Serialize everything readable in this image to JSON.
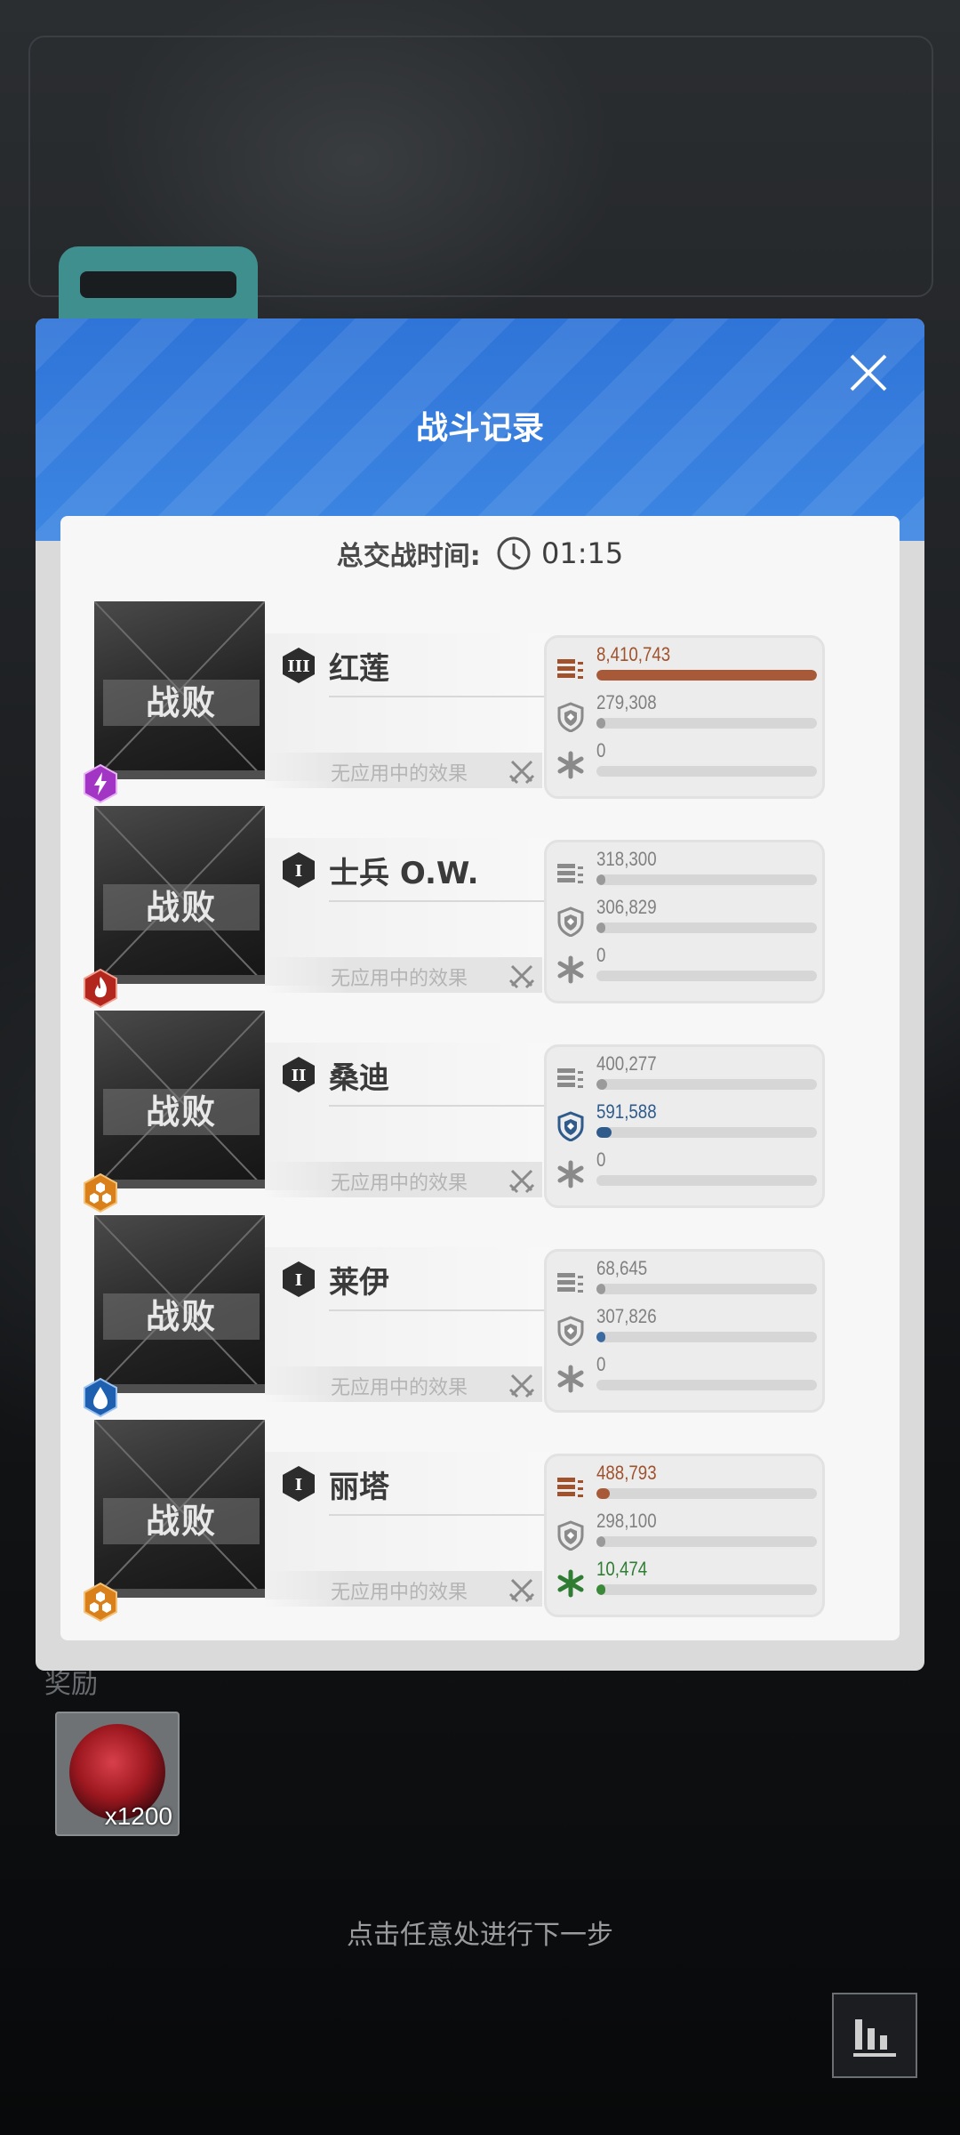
{
  "dialog": {
    "title": "战斗记录",
    "duration_label": "总交战时间:",
    "duration_value": "01:15"
  },
  "units": [
    {
      "name": "红莲",
      "rank": "III",
      "status": "战败",
      "element_icon": "lightning-icon",
      "element_color": "#a335c4",
      "effect_text": "无应用中的效果",
      "stats": [
        {
          "icon": "ammo-icon",
          "value": "8,410,743",
          "fill": 1.0,
          "color": "#a85a38",
          "text_color": "#a0522d"
        },
        {
          "icon": "shield-icon",
          "value": "279,308",
          "fill": 0.03,
          "color": "#9a9a9a",
          "text_color": "#808080"
        },
        {
          "icon": "heal-icon",
          "value": "0",
          "fill": 0.0,
          "color": "#9a9a9a",
          "text_color": "#808080"
        }
      ]
    },
    {
      "name": "士兵 O.W.",
      "rank": "I",
      "status": "战败",
      "element_icon": "fire-icon",
      "element_color": "#b3261e",
      "effect_text": "无应用中的效果",
      "stats": [
        {
          "icon": "ammo-icon",
          "value": "318,300",
          "fill": 0.03,
          "color": "#9a9a9a",
          "text_color": "#808080"
        },
        {
          "icon": "shield-icon",
          "value": "306,829",
          "fill": 0.03,
          "color": "#9a9a9a",
          "text_color": "#808080"
        },
        {
          "icon": "heal-icon",
          "value": "0",
          "fill": 0.0,
          "color": "#9a9a9a",
          "text_color": "#808080"
        }
      ]
    },
    {
      "name": "桑迪",
      "rank": "II",
      "status": "战败",
      "element_icon": "iron-icon",
      "element_color": "#d9801a",
      "effect_text": "无应用中的效果",
      "stats": [
        {
          "icon": "ammo-icon",
          "value": "400,277",
          "fill": 0.05,
          "color": "#9a9a9a",
          "text_color": "#808080"
        },
        {
          "icon": "shield-icon",
          "value": "591,588",
          "fill": 0.07,
          "color": "#2e5a8c",
          "text_color": "#2e5a8c"
        },
        {
          "icon": "heal-icon",
          "value": "0",
          "fill": 0.0,
          "color": "#9a9a9a",
          "text_color": "#808080"
        }
      ]
    },
    {
      "name": "莱伊",
      "rank": "I",
      "status": "战败",
      "element_icon": "water-icon",
      "element_color": "#1f5fb0",
      "effect_text": "无应用中的效果",
      "stats": [
        {
          "icon": "ammo-icon",
          "value": "68,645",
          "fill": 0.01,
          "color": "#9a9a9a",
          "text_color": "#808080"
        },
        {
          "icon": "shield-icon",
          "value": "307,826",
          "fill": 0.03,
          "color": "#3a6aa0",
          "text_color": "#808080"
        },
        {
          "icon": "heal-icon",
          "value": "0",
          "fill": 0.0,
          "color": "#9a9a9a",
          "text_color": "#808080"
        }
      ]
    },
    {
      "name": "丽塔",
      "rank": "I",
      "status": "战败",
      "element_icon": "iron-icon",
      "element_color": "#d9801a",
      "effect_text": "无应用中的效果",
      "stats": [
        {
          "icon": "ammo-icon",
          "value": "488,793",
          "fill": 0.06,
          "color": "#a85a38",
          "text_color": "#a0522d"
        },
        {
          "icon": "shield-icon",
          "value": "298,100",
          "fill": 0.03,
          "color": "#9a9a9a",
          "text_color": "#808080"
        },
        {
          "icon": "heal-icon",
          "value": "10,474",
          "fill": 0.01,
          "color": "#3a8a3a",
          "text_color": "#2e7d32"
        }
      ]
    }
  ],
  "background": {
    "reward_label": "奖励",
    "reward_quantity": "x1200",
    "hint": "点击任意处进行下一步"
  }
}
